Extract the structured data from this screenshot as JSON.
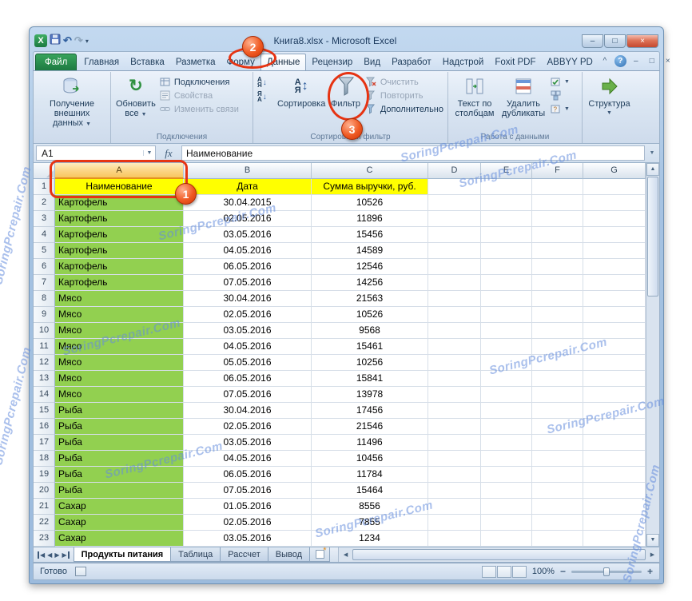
{
  "window": {
    "title": "Книга8.xlsx - Microsoft Excel"
  },
  "ribbon_tabs": [
    {
      "label": "Файл",
      "file": true
    },
    {
      "label": "Главная"
    },
    {
      "label": "Вставка"
    },
    {
      "label": "Разметка"
    },
    {
      "label": "Форму"
    },
    {
      "label": "Данные",
      "active": true
    },
    {
      "label": "Рецензир"
    },
    {
      "label": "Вид"
    },
    {
      "label": "Разработ"
    },
    {
      "label": "Надстрой"
    },
    {
      "label": "Foxit PDF"
    },
    {
      "label": "ABBYY PD"
    }
  ],
  "ribbon": {
    "get_external_1": "Получение",
    "get_external_2": "внешних данных",
    "refresh_1": "Обновить",
    "refresh_2": "все",
    "connections": "Подключения",
    "properties": "Свойства",
    "edit_links": "Изменить связи",
    "connections_caption": "Подключения",
    "sort": "Сортировка",
    "filter": "Фильтр",
    "clear": "Очистить",
    "reapply": "Повторить",
    "advanced": "Дополнительно",
    "sort_filter_caption": "Сортировка и фильтр",
    "ttc_1": "Текст по",
    "ttc_2": "столбцам",
    "dup_1": "Удалить",
    "dup_2": "дубликаты",
    "data_tools_caption": "Работа с данными",
    "outline": "Структура",
    "sort_a": "А",
    "sort_z": "Я"
  },
  "formula_bar": {
    "name_box": "A1",
    "fx": "fx",
    "value": "Наименование"
  },
  "sheet": {
    "columns": [
      "A",
      "B",
      "C",
      "D",
      "E",
      "F",
      "G"
    ],
    "rows": [
      [
        "Наименование",
        "Дата",
        "Сумма выручки, руб."
      ],
      [
        "Картофель",
        "30.04.2015",
        "10526"
      ],
      [
        "Картофель",
        "02.05.2016",
        "11896"
      ],
      [
        "Картофель",
        "03.05.2016",
        "15456"
      ],
      [
        "Картофель",
        "04.05.2016",
        "14589"
      ],
      [
        "Картофель",
        "06.05.2016",
        "12546"
      ],
      [
        "Картофель",
        "07.05.2016",
        "14256"
      ],
      [
        "Мясо",
        "30.04.2016",
        "21563"
      ],
      [
        "Мясо",
        "02.05.2016",
        "10526"
      ],
      [
        "Мясо",
        "03.05.2016",
        "9568"
      ],
      [
        "Мясо",
        "04.05.2016",
        "15461"
      ],
      [
        "Мясо",
        "05.05.2016",
        "10256"
      ],
      [
        "Мясо",
        "06.05.2016",
        "15841"
      ],
      [
        "Мясо",
        "07.05.2016",
        "13978"
      ],
      [
        "Рыба",
        "30.04.2016",
        "17456"
      ],
      [
        "Рыба",
        "02.05.2016",
        "21546"
      ],
      [
        "Рыба",
        "03.05.2016",
        "11496"
      ],
      [
        "Рыба",
        "04.05.2016",
        "10456"
      ],
      [
        "Рыба",
        "06.05.2016",
        "11784"
      ],
      [
        "Рыба",
        "07.05.2016",
        "15464"
      ],
      [
        "Сахар",
        "01.05.2016",
        "8556"
      ],
      [
        "Сахар",
        "02.05.2016",
        "7855"
      ],
      [
        "Сахар",
        "03.05.2016",
        "1234"
      ]
    ]
  },
  "sheet_tabs": [
    {
      "label": "Продукты питания",
      "active": true
    },
    {
      "label": "Таблица"
    },
    {
      "label": "Рассчет"
    },
    {
      "label": "Вывод"
    }
  ],
  "status": {
    "ready": "Готово",
    "zoom": "100%"
  },
  "annotations": {
    "step1": "1",
    "step2": "2",
    "step3": "3"
  },
  "watermark": "SoringPcrepair.Com",
  "colors": {
    "header_fill": "#ffff00",
    "category_fill": "#92d050",
    "annotation": "#e63312"
  }
}
